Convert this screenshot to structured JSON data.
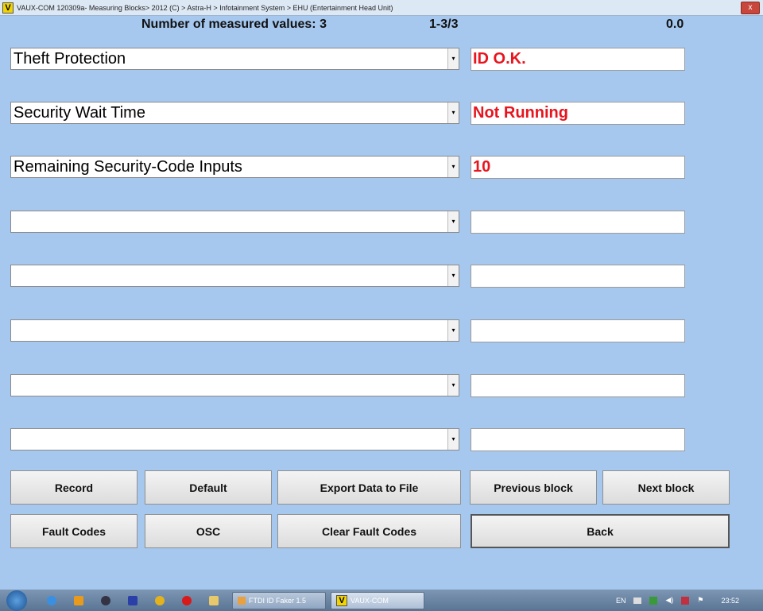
{
  "window": {
    "title": "VAUX-COM 120309a- Measuring Blocks> 2012 (C) > Astra-H > Infotainment System > EHU (Entertainment Head Unit)",
    "logo": "V",
    "close": "x"
  },
  "header": {
    "count_label": "Number of measured values: 3",
    "range": "1-3/3",
    "value": "0.0"
  },
  "rows": [
    {
      "label": "Theft Protection",
      "value": "ID O.K."
    },
    {
      "label": "Security Wait Time",
      "value": "Not Running"
    },
    {
      "label": "Remaining Security-Code Inputs",
      "value": "10"
    },
    {
      "label": "",
      "value": ""
    },
    {
      "label": "",
      "value": ""
    },
    {
      "label": "",
      "value": ""
    },
    {
      "label": "",
      "value": ""
    },
    {
      "label": "",
      "value": ""
    }
  ],
  "buttons": {
    "record": "Record",
    "default": "Default",
    "export": "Export Data to File",
    "previous": "Previous block",
    "next": "Next block",
    "fault_codes": "Fault Codes",
    "osc": "OSC",
    "clear": "Clear Fault Codes",
    "back": "Back"
  },
  "taskbar": {
    "tasks": [
      "FTDI ID Faker 1.5",
      "VAUX-COM"
    ],
    "lang": "EN",
    "clock": "23:52"
  },
  "colors": {
    "value_text": "#e8141e",
    "background": "#a6c8ef"
  }
}
